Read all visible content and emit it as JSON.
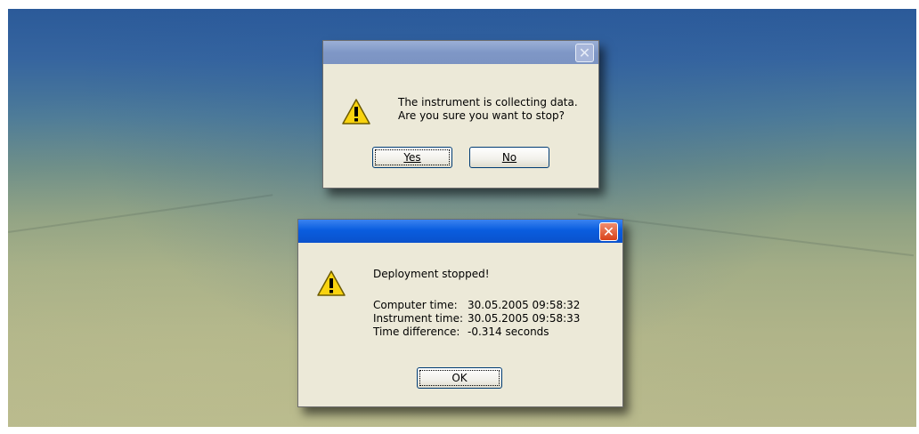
{
  "confirm_dialog": {
    "message_line1": "The instrument is collecting data.",
    "message_line2": "Are you sure you want to stop?",
    "yes_label": "Yes",
    "no_label": "No",
    "close_glyph": "✕"
  },
  "status_dialog": {
    "heading": "Deployment stopped!",
    "rows": [
      {
        "label": "Computer time:",
        "value": "30.05.2005 09:58:32"
      },
      {
        "label": "Instrument time:",
        "value": "30.05.2005 09:58:33"
      },
      {
        "label": "Time difference:",
        "value": "-0.314 seconds"
      }
    ],
    "ok_label": "OK",
    "close_glyph": "✕"
  },
  "icons": {
    "warning": "warning-icon",
    "close": "close-icon"
  },
  "colors": {
    "title_active": "#0a5ddf",
    "title_inactive": "#7f97c6",
    "dialog_face": "#ece9d8",
    "close_active": "#d9421a"
  }
}
